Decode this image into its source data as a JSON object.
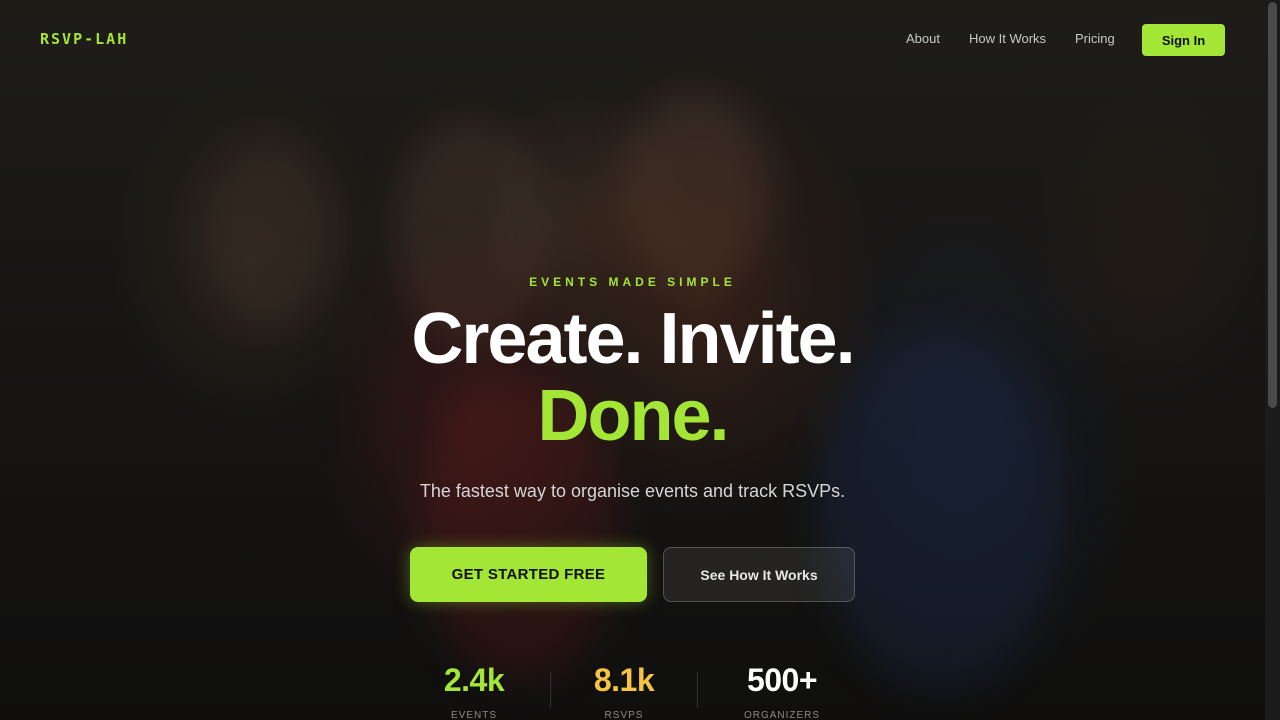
{
  "nav": {
    "logo": "RSVP-LAH",
    "links": [
      "About",
      "How It Works",
      "Pricing"
    ],
    "signin_label": "Sign In"
  },
  "hero": {
    "eyebrow": "EVENTS MADE SIMPLE",
    "headline": "Create. Invite.",
    "headline_accent": "Done.",
    "subtitle": "The fastest way to organise events and track RSVPs.",
    "primary_cta": "GET STARTED FREE",
    "secondary_cta": "See How It Works"
  },
  "stats": [
    {
      "value": "2.4k",
      "label": "EVENTS",
      "color": "#a3e635"
    },
    {
      "value": "8.1k",
      "label": "RSVPS",
      "color": "#f5c542"
    },
    {
      "value": "500+",
      "label": "ORGANIZERS",
      "color": "#ffffff"
    }
  ],
  "colors": {
    "accent": "#a3e635",
    "accent_yellow": "#f5c542",
    "background": "#141312"
  }
}
